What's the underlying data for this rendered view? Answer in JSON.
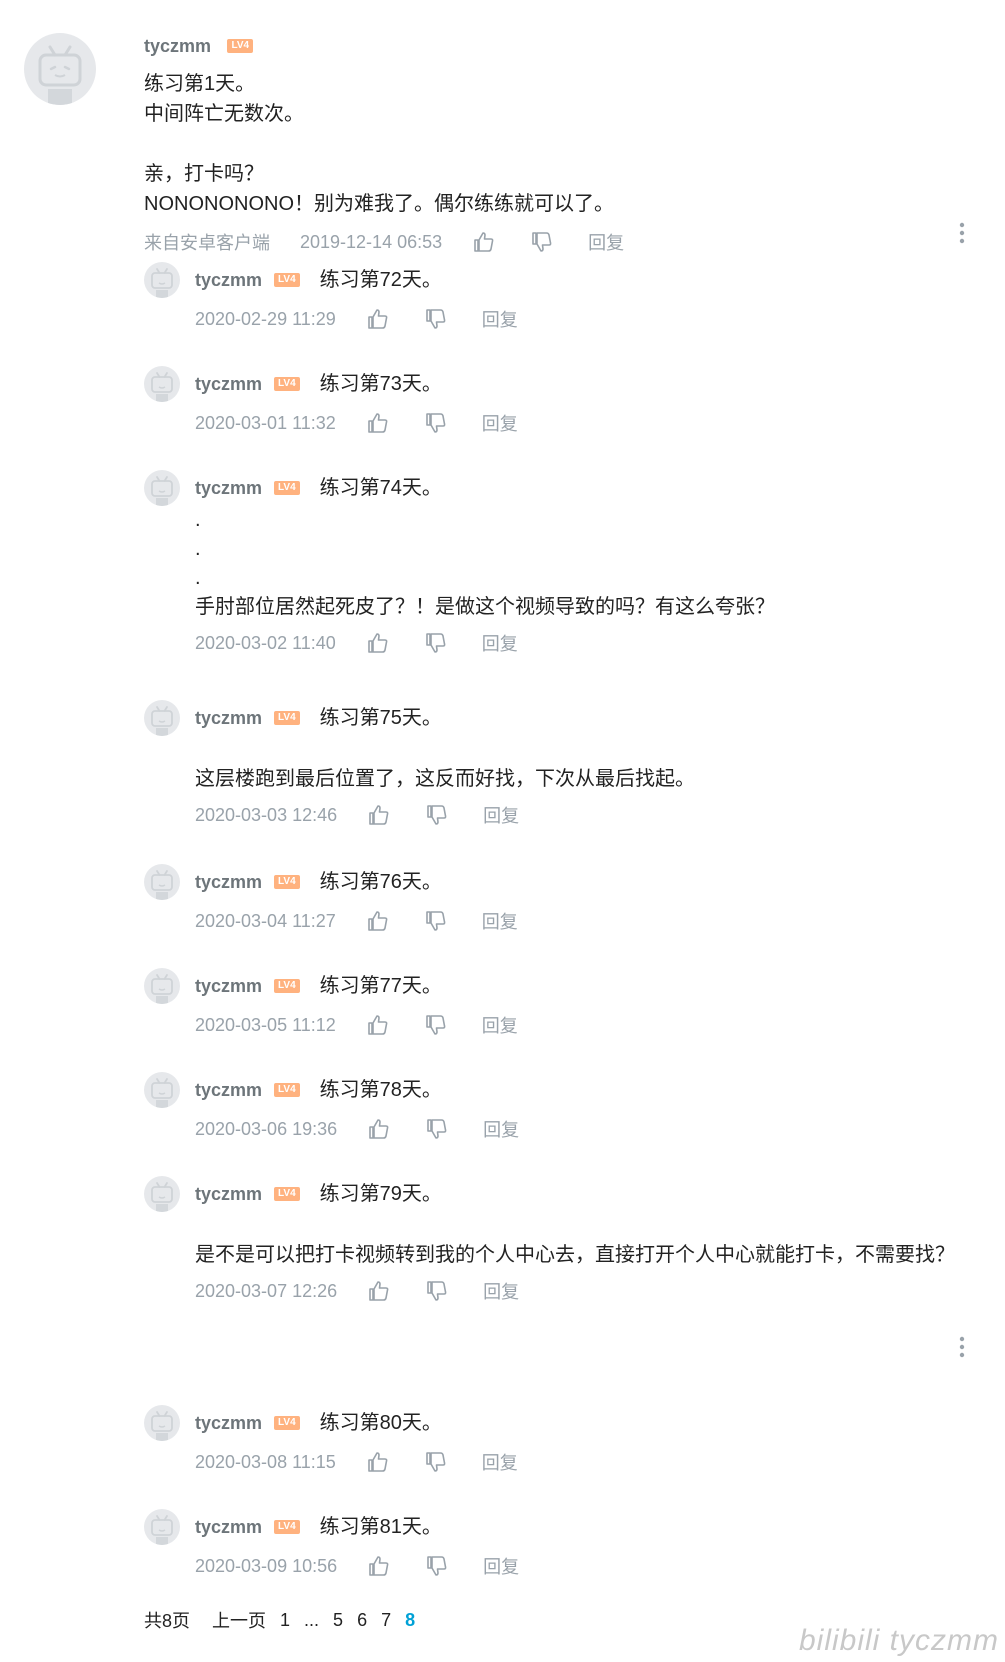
{
  "root": {
    "username": "tyczmm",
    "level": "LV4",
    "lines": "练习第1天。\n中间阵亡无数次。\n\n亲，打卡吗？\nNONONONONO！别为难我了。偶尔练练就可以了。",
    "source": "来自安卓客户端",
    "time": "2019-12-14 06:53",
    "reply_label": "回复"
  },
  "replies": [
    {
      "username": "tyczmm",
      "level": "LV4",
      "first": "练习第72天。",
      "more": "",
      "time": "2020-02-29 11:29",
      "reply_label": "回复"
    },
    {
      "username": "tyczmm",
      "level": "LV4",
      "first": "练习第73天。",
      "more": "",
      "time": "2020-03-01 11:32",
      "reply_label": "回复"
    },
    {
      "username": "tyczmm",
      "level": "LV4",
      "first": "练习第74天。",
      "more": ".\n.\n.\n手肘部位居然起死皮了？！是做这个视频导致的吗？有这么夸张？",
      "time": "2020-03-02 11:40",
      "reply_label": "回复"
    },
    {
      "username": "tyczmm",
      "level": "LV4",
      "first": "练习第75天。",
      "more": "\n这层楼跑到最后位置了，这反而好找，下次从最后找起。",
      "time": "2020-03-03 12:46",
      "reply_label": "回复"
    },
    {
      "username": "tyczmm",
      "level": "LV4",
      "first": "练习第76天。",
      "more": "",
      "time": "2020-03-04 11:27",
      "reply_label": "回复"
    },
    {
      "username": "tyczmm",
      "level": "LV4",
      "first": "练习第77天。",
      "more": "",
      "time": "2020-03-05 11:12",
      "reply_label": "回复"
    },
    {
      "username": "tyczmm",
      "level": "LV4",
      "first": "练习第78天。",
      "more": "",
      "time": "2020-03-06 19:36",
      "reply_label": "回复"
    },
    {
      "username": "tyczmm",
      "level": "LV4",
      "first": "练习第79天。",
      "more": "\n是不是可以把打卡视频转到我的个人中心去，直接打开个人中心就能打卡，不需要找？",
      "time": "2020-03-07 12:26",
      "reply_label": "回复"
    },
    {
      "username": "tyczmm",
      "level": "LV4",
      "first": "练习第80天。",
      "more": "",
      "time": "2020-03-08 11:15",
      "reply_label": "回复"
    },
    {
      "username": "tyczmm",
      "level": "LV4",
      "first": "练习第81天。",
      "more": "",
      "time": "2020-03-09 10:56",
      "reply_label": "回复"
    }
  ],
  "pager": {
    "total": "共8页",
    "prev": "上一页",
    "pages": [
      "1",
      "...",
      "5",
      "6",
      "7",
      "8"
    ],
    "current": "8"
  },
  "watermark": "bilibili tyczmm"
}
